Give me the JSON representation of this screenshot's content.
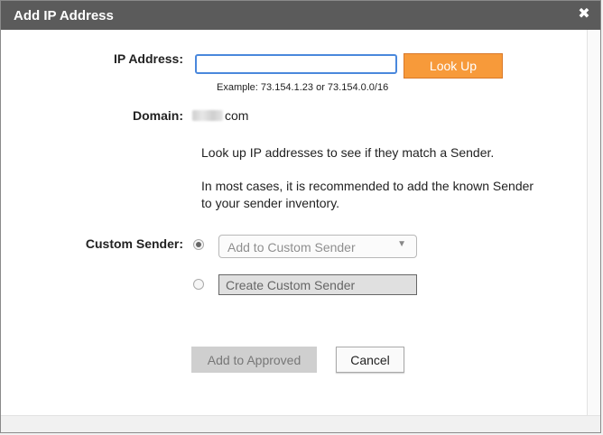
{
  "dialog": {
    "title": "Add IP Address",
    "close_glyph": "✖"
  },
  "ip": {
    "label": "IP Address:",
    "value": "",
    "lookup_label": "Look Up",
    "example": "Example: 73.154.1.23 or 73.154.0.0/16"
  },
  "domain": {
    "label": "Domain:",
    "value_suffix": "com"
  },
  "info": {
    "line1": "Look up IP addresses to see if they match a Sender.",
    "line2": "In most cases, it is recommended to add the known Sender",
    "line3": "to your sender inventory."
  },
  "custom_sender": {
    "label": "Custom Sender:",
    "select_value": "Add to Custom Sender",
    "select_chevron": "▼",
    "create_label": "Create Custom Sender",
    "selected_option": "add"
  },
  "actions": {
    "approve_label": "Add to Approved",
    "cancel_label": "Cancel"
  },
  "colors": {
    "titlebar": "#5b5b5b",
    "lookup_button": "#f79a3a",
    "input_focus_border": "#4a88dc"
  },
  "icons": {
    "close": "close-icon",
    "dropdown": "chevron-down-icon"
  }
}
